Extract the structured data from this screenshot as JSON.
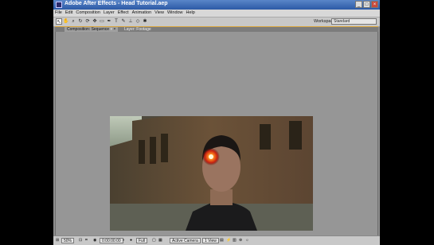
{
  "window": {
    "title": "Adobe After Effects - Head Tutorial.aep",
    "buttons": [
      "_",
      "□",
      "×"
    ]
  },
  "menu": [
    "File",
    "Edit",
    "Composition",
    "Layer",
    "Effect",
    "Animation",
    "View",
    "Window",
    "Help"
  ],
  "workspace": {
    "label": "Workspace:",
    "value": "Standard"
  },
  "tabs": {
    "composition": "Composition: Sequence",
    "layer": "Layer: Footage"
  },
  "bottom_bar": {
    "zoom": "50%",
    "timecode": "0:00:00:00",
    "resolution": "Full",
    "camera": "Active Camera",
    "views": "1 View"
  },
  "colors": {
    "panel_bg": "#969696",
    "title_bar": "#3a68b4",
    "tab_accent": "#d8a43a"
  }
}
